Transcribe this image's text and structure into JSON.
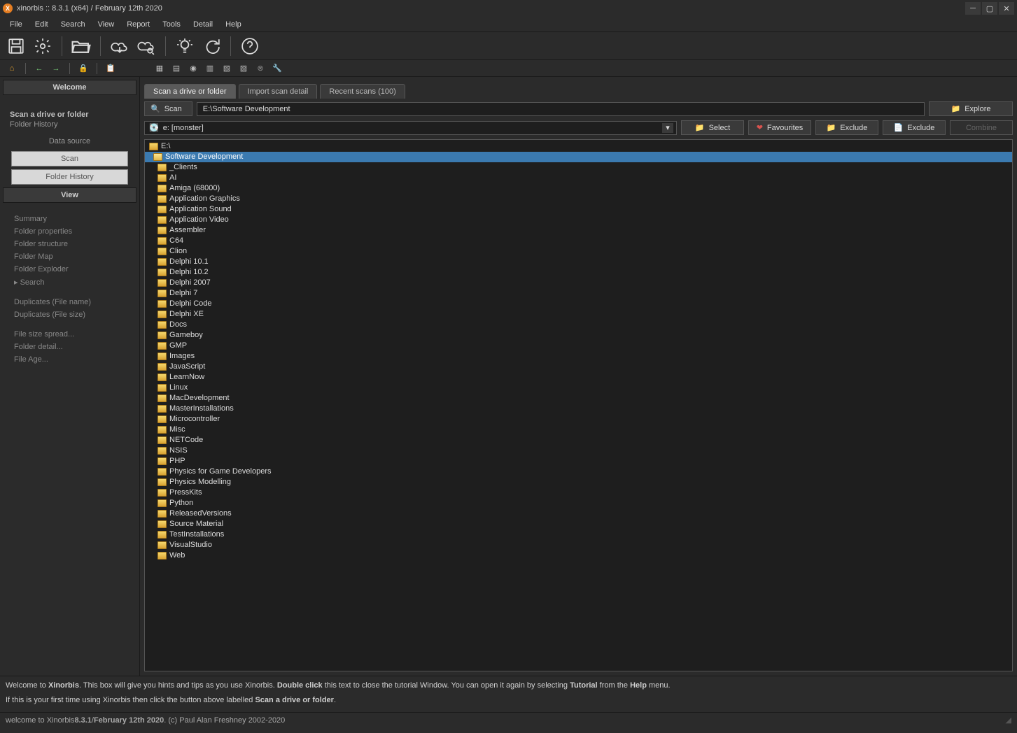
{
  "title": "xinorbis :: 8.3.1 (x64) / February 12th 2020",
  "menus": [
    "File",
    "Edit",
    "Search",
    "View",
    "Report",
    "Tools",
    "Detail",
    "Help"
  ],
  "sidebar": {
    "welcome": "Welcome",
    "scan_header": "Scan a drive or folder",
    "folder_history_label": "Folder History",
    "data_source": "Data source",
    "scan_btn": "Scan",
    "folder_history_btn": "Folder History",
    "view_header": "View",
    "links": [
      "Summary",
      "Folder properties",
      "Folder structure",
      "Folder Map",
      "Folder Exploder",
      "Search"
    ],
    "dup_links": [
      "Duplicates (File name)",
      "Duplicates (File size)"
    ],
    "detail_links": [
      "File size spread...",
      "Folder detail...",
      "File Age..."
    ]
  },
  "tabs": [
    {
      "label": "Scan a drive or folder",
      "active": true
    },
    {
      "label": "Import scan detail",
      "active": false
    },
    {
      "label": "Recent scans (100)",
      "active": false
    }
  ],
  "scan_button": "Scan",
  "path_value": "E:\\Software Development",
  "explore_btn": "Explore",
  "drive_value": "e: [monster]",
  "row_buttons": [
    {
      "label": "Select",
      "icon": "folder",
      "cls": ""
    },
    {
      "label": "Favourites",
      "icon": "fav",
      "cls": ""
    },
    {
      "label": "Exclude",
      "icon": "folder",
      "cls": ""
    },
    {
      "label": "Exclude",
      "icon": "excl",
      "cls": ""
    },
    {
      "label": "Combine",
      "icon": "",
      "cls": "disabled"
    }
  ],
  "tree": [
    {
      "name": "E:\\",
      "depth": 0,
      "selected": false
    },
    {
      "name": "Software Development",
      "depth": 1,
      "selected": true
    },
    {
      "name": "_Clients",
      "depth": 2
    },
    {
      "name": "AI",
      "depth": 2
    },
    {
      "name": "Amiga (68000)",
      "depth": 2
    },
    {
      "name": "Application Graphics",
      "depth": 2
    },
    {
      "name": "Application Sound",
      "depth": 2
    },
    {
      "name": "Application Video",
      "depth": 2
    },
    {
      "name": "Assembler",
      "depth": 2
    },
    {
      "name": "C64",
      "depth": 2
    },
    {
      "name": "Clion",
      "depth": 2
    },
    {
      "name": "Delphi 10.1",
      "depth": 2
    },
    {
      "name": "Delphi 10.2",
      "depth": 2
    },
    {
      "name": "Delphi 2007",
      "depth": 2
    },
    {
      "name": "Delphi 7",
      "depth": 2
    },
    {
      "name": "Delphi Code",
      "depth": 2
    },
    {
      "name": "Delphi XE",
      "depth": 2
    },
    {
      "name": "Docs",
      "depth": 2
    },
    {
      "name": "Gameboy",
      "depth": 2
    },
    {
      "name": "GMP",
      "depth": 2
    },
    {
      "name": "Images",
      "depth": 2
    },
    {
      "name": "JavaScript",
      "depth": 2
    },
    {
      "name": "LearnNow",
      "depth": 2
    },
    {
      "name": "Linux",
      "depth": 2
    },
    {
      "name": "MacDevelopment",
      "depth": 2
    },
    {
      "name": "MasterInstallations",
      "depth": 2
    },
    {
      "name": "Microcontroller",
      "depth": 2
    },
    {
      "name": "Misc",
      "depth": 2
    },
    {
      "name": "NETCode",
      "depth": 2
    },
    {
      "name": "NSIS",
      "depth": 2
    },
    {
      "name": "PHP",
      "depth": 2
    },
    {
      "name": "Physics for Game Developers",
      "depth": 2
    },
    {
      "name": "Physics Modelling",
      "depth": 2
    },
    {
      "name": "PressKits",
      "depth": 2
    },
    {
      "name": "Python",
      "depth": 2
    },
    {
      "name": "ReleasedVersions",
      "depth": 2
    },
    {
      "name": "Source Material",
      "depth": 2
    },
    {
      "name": "TestInstallations",
      "depth": 2
    },
    {
      "name": "VisualStudio",
      "depth": 2
    },
    {
      "name": "Web",
      "depth": 2
    }
  ],
  "hint": {
    "l1a": "Welcome to ",
    "l1b": "Xinorbis",
    "l1c": ". This box will give you hints and tips as you use Xinorbis. ",
    "l1d": "Double click",
    "l1e": " this text to close the tutorial Window. You can open it again by selecting ",
    "l1f": "Tutorial",
    "l1g": " from the ",
    "l1h": "Help",
    "l1i": " menu.",
    "l2a": "If this is your first time using Xinorbis then click the button above labelled ",
    "l2b": "Scan a drive or folder",
    "l2c": "."
  },
  "status": {
    "a": "welcome to Xinorbis ",
    "b": "8.3.1",
    "c": " / ",
    "d": "February 12th 2020",
    "e": ". (c) Paul Alan Freshney 2002-2020"
  }
}
